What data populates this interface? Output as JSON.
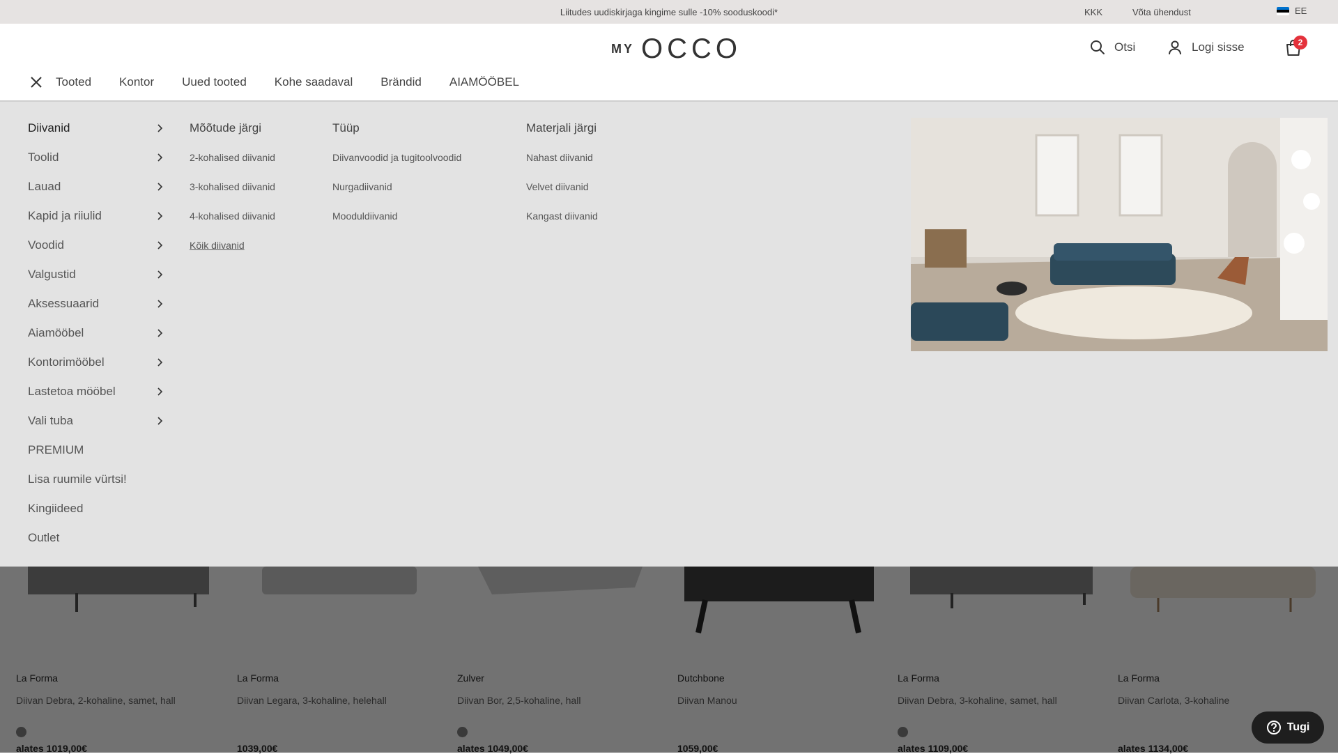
{
  "topbar": {
    "promo": "Liitudes uudiskirjaga kingime sulle -10% sooduskoodi*",
    "faq": "KKK",
    "contact": "Võta ühendust",
    "lang": "EE",
    "flag_colors": [
      "#0072ce",
      "#000000",
      "#ffffff"
    ]
  },
  "header": {
    "logo_my": "MY",
    "logo_occo": "OCCO",
    "search_label": "Otsi",
    "login_label": "Logi sisse",
    "cart_count": "2"
  },
  "nav": {
    "items": [
      "Tooted",
      "Kontor",
      "Uued tooted",
      "Kohe saadaval",
      "Brändid",
      "AIAMÖÖBEL"
    ]
  },
  "menu": {
    "categories": [
      {
        "label": "Diivanid",
        "arrow": true
      },
      {
        "label": "Toolid",
        "arrow": true
      },
      {
        "label": "Lauad",
        "arrow": true
      },
      {
        "label": "Kapid ja riiulid",
        "arrow": true
      },
      {
        "label": "Voodid",
        "arrow": true
      },
      {
        "label": "Valgustid",
        "arrow": true
      },
      {
        "label": "Aksessuaarid",
        "arrow": true
      },
      {
        "label": "Aiamööbel",
        "arrow": true
      },
      {
        "label": "Kontorimööbel",
        "arrow": true
      },
      {
        "label": "Lastetoa mööbel",
        "arrow": true
      },
      {
        "label": "Vali tuba",
        "arrow": true
      },
      {
        "label": "PREMIUM",
        "arrow": false
      },
      {
        "label": "Lisa ruumile vürtsi!",
        "arrow": false
      },
      {
        "label": "Kingiideed",
        "arrow": false
      },
      {
        "label": "Outlet",
        "arrow": false
      }
    ],
    "columns": [
      {
        "title": "Mõõtude järgi",
        "items": [
          "2-kohalised diivanid",
          "3-kohalised diivanid",
          "4-kohalised diivanid",
          "Kõik diivanid"
        ]
      },
      {
        "title": "Tüüp",
        "items": [
          "Diivanvoodid ja tugitoolvoodid",
          "Nurgadiivanid",
          "Mooduldiivanid"
        ]
      },
      {
        "title": "Materjali järgi",
        "items": [
          "Nahast diivanid",
          "Velvet diivanid",
          "Kangast diivanid"
        ]
      }
    ]
  },
  "products": [
    {
      "brand": "La Forma",
      "name": "Diivan Debra, 2-kohaline, samet, hall",
      "price": "alates 1019,00€",
      "has_swatch": true
    },
    {
      "brand": "La Forma",
      "name": "Diivan Legara, 3-kohaline, helehall",
      "price": "1039,00€",
      "has_swatch": false
    },
    {
      "brand": "Zulver",
      "name": "Diivan Bor, 2,5-kohaline, hall",
      "price": "alates 1049,00€",
      "has_swatch": true
    },
    {
      "brand": "Dutchbone",
      "name": "Diivan Manou",
      "price": "1059,00€",
      "has_swatch": false
    },
    {
      "brand": "La Forma",
      "name": "Diivan Debra, 3-kohaline, samet, hall",
      "price": "alates 1109,00€",
      "has_swatch": true
    },
    {
      "brand": "La Forma",
      "name": "Diivan Carlota, 3-kohaline",
      "price": "alates 1134,00€",
      "has_swatch": false
    }
  ],
  "support": {
    "label": "Tugi"
  }
}
